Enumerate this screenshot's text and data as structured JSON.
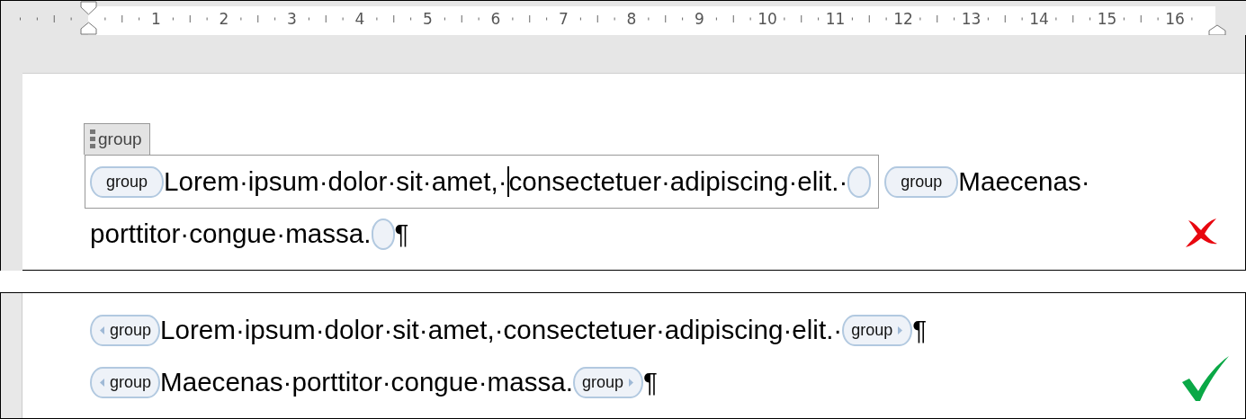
{
  "ruler": {
    "numbers": [
      "1",
      "2",
      "3",
      "4",
      "5",
      "6",
      "7",
      "8",
      "9",
      "10",
      "11",
      "12",
      "13",
      "14",
      "15",
      "16"
    ]
  },
  "panels": [
    {
      "kind": "incorrect",
      "lines": [
        [
          {
            "kind": "control",
            "title": "group",
            "segments": [
              {
                "kind": "tag_open",
                "label": "group"
              },
              {
                "kind": "text",
                "text": "Lorem·ipsum·dolor·sit·amet,·"
              },
              {
                "kind": "caret"
              },
              {
                "kind": "text",
                "text": "consectetuer·adipiscing·elit.·"
              },
              {
                "kind": "tag_close"
              }
            ]
          },
          {
            "kind": "tag_open",
            "label": "group"
          },
          {
            "kind": "text",
            "text": "Maecenas·"
          }
        ],
        [
          {
            "kind": "text",
            "text": "porttitor·congue·massa."
          },
          {
            "kind": "tag_close"
          },
          {
            "kind": "pilcrow",
            "text": "¶"
          }
        ]
      ]
    },
    {
      "kind": "correct",
      "lines": [
        [
          {
            "kind": "tag_open",
            "label": "group",
            "arrow": true
          },
          {
            "kind": "text",
            "text": "Lorem·ipsum·dolor·sit·amet,·consectetuer·adipiscing·elit.·"
          },
          {
            "kind": "tag_close",
            "label": "group",
            "arrow": true
          },
          {
            "kind": "pilcrow",
            "text": "¶"
          }
        ],
        [
          {
            "kind": "tag_open",
            "label": "group",
            "arrow": true
          },
          {
            "kind": "text",
            "text": "Maecenas·porttitor·congue·massa."
          },
          {
            "kind": "tag_close",
            "label": "group",
            "arrow": true
          },
          {
            "kind": "pilcrow",
            "text": "¶"
          }
        ]
      ]
    }
  ]
}
